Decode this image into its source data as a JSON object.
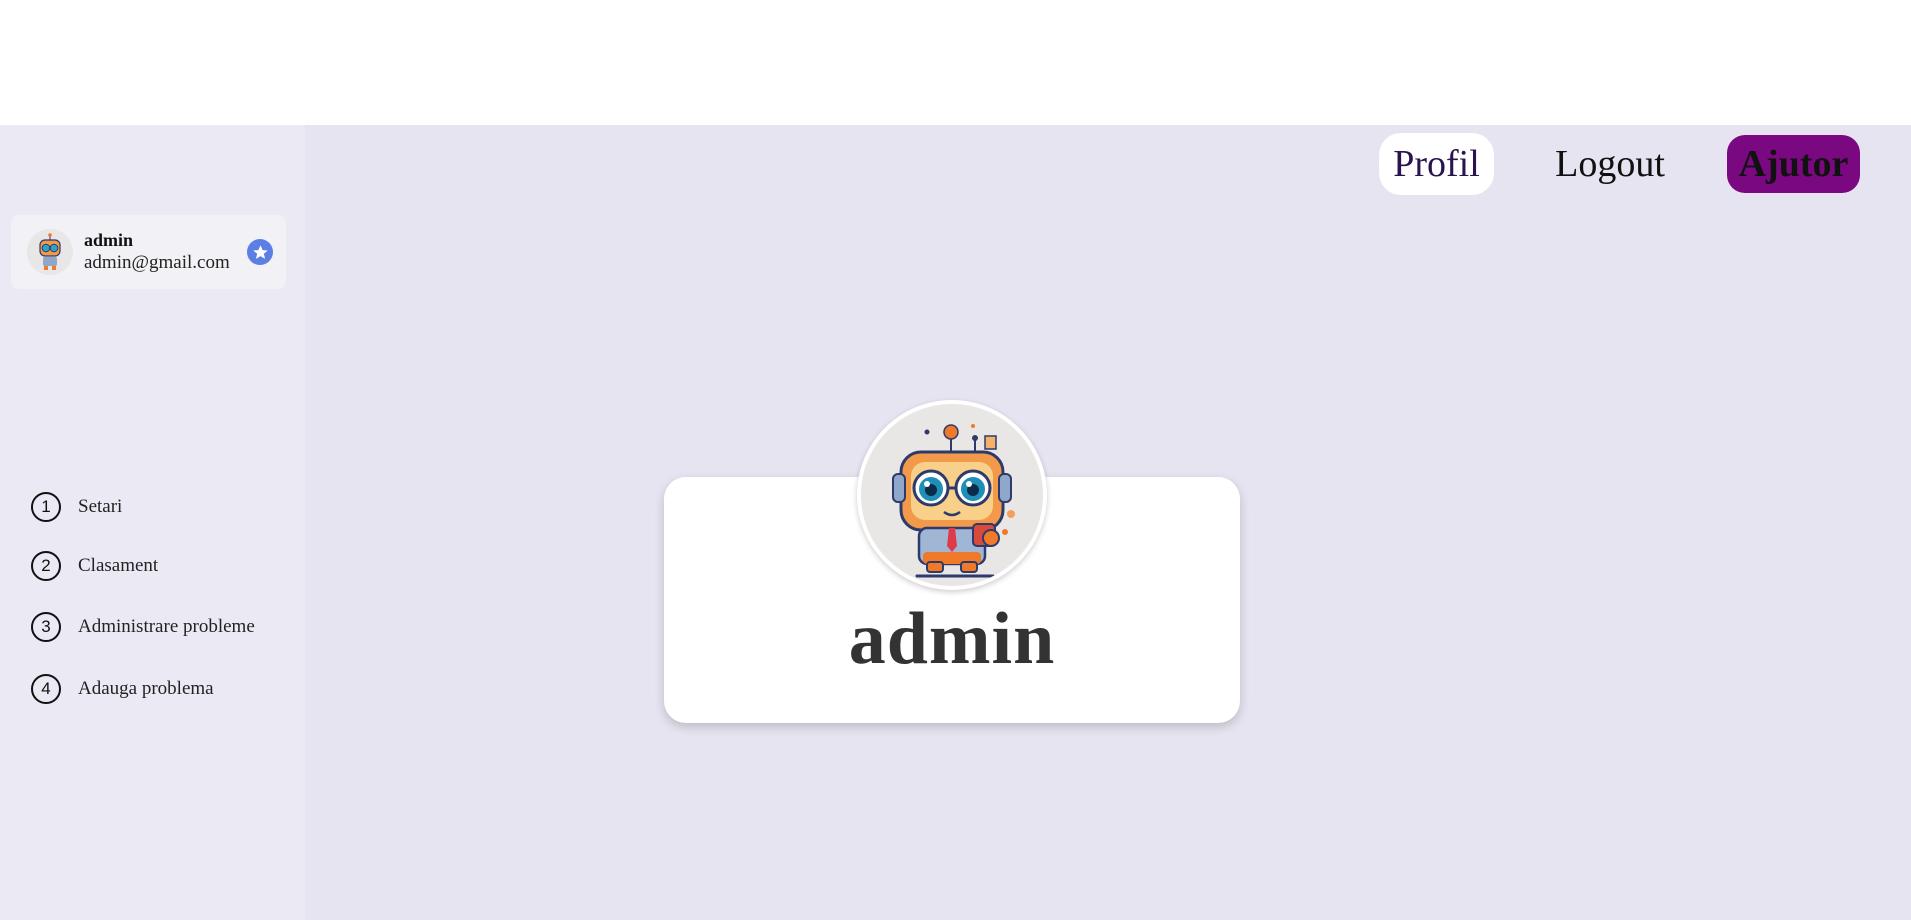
{
  "header": {
    "buttons": {
      "profil": "Profil",
      "logout": "Logout",
      "ajutor": "Ajutor"
    }
  },
  "sidebar": {
    "user": {
      "name": "admin",
      "email": "admin@gmail.com",
      "badge_icon": "star-icon"
    },
    "items": [
      {
        "number": "1",
        "label": "Setari"
      },
      {
        "number": "2",
        "label": "Clasament"
      },
      {
        "number": "3",
        "label": "Administrare probleme"
      },
      {
        "number": "4",
        "label": "Adauga problema"
      }
    ]
  },
  "profile": {
    "name": "admin",
    "avatar_icon": "robot-avatar-icon"
  },
  "colors": {
    "background": "#e6e4f0",
    "sidebar": "#ebe9f3",
    "ajutor_button": "#7a0880",
    "badge": "#5b7fe3"
  }
}
